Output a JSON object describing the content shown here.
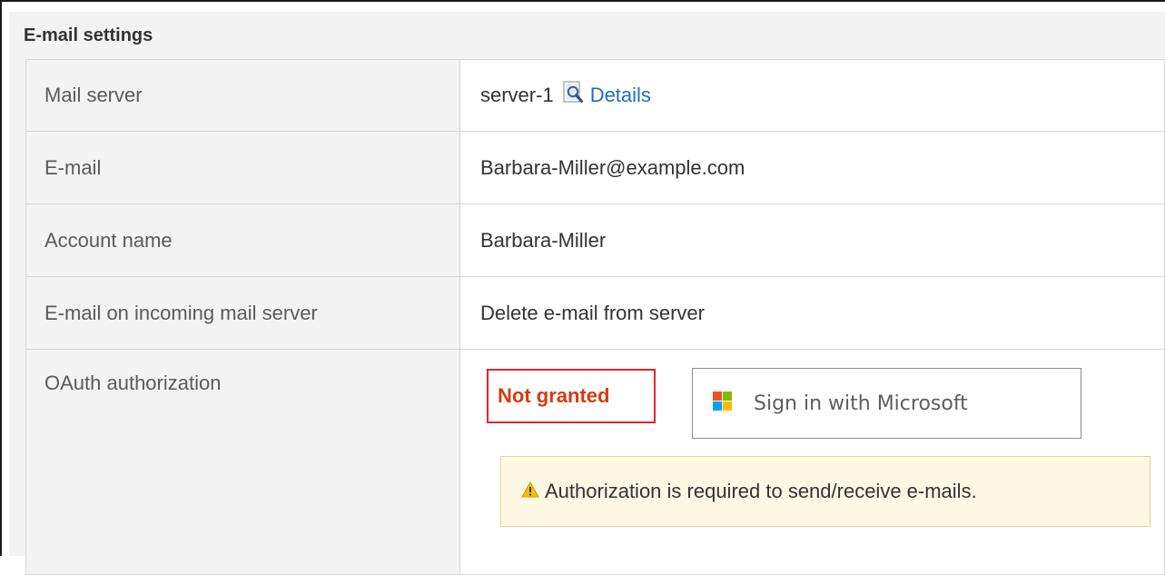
{
  "section": {
    "title": "E-mail settings"
  },
  "rows": {
    "mail_server": {
      "label": "Mail server",
      "server_name": "server-1",
      "details_link": "Details"
    },
    "email": {
      "label": "E-mail",
      "value": "Barbara-Miller@example.com"
    },
    "account_name": {
      "label": "Account name",
      "value": "Barbara-Miller"
    },
    "incoming": {
      "label": "E-mail on incoming mail server",
      "value": "Delete e-mail from server"
    },
    "oauth": {
      "label": "OAuth authorization",
      "status": "Not granted",
      "signin_button": "Sign in with Microsoft",
      "warning": "Authorization is required to send/receive e-mails."
    }
  },
  "colors": {
    "status_red": "#d63a0f",
    "status_border": "#e8242b",
    "link_blue": "#1f6dbf",
    "warning_bg": "#fcf8e3",
    "ms_red": "#f25022",
    "ms_green": "#7fba00",
    "ms_blue": "#00a4ef",
    "ms_yellow": "#ffb900"
  },
  "icons": {
    "details": "magnifier-document-icon",
    "signin": "microsoft-logo-icon",
    "warning": "warning-triangle-icon"
  }
}
